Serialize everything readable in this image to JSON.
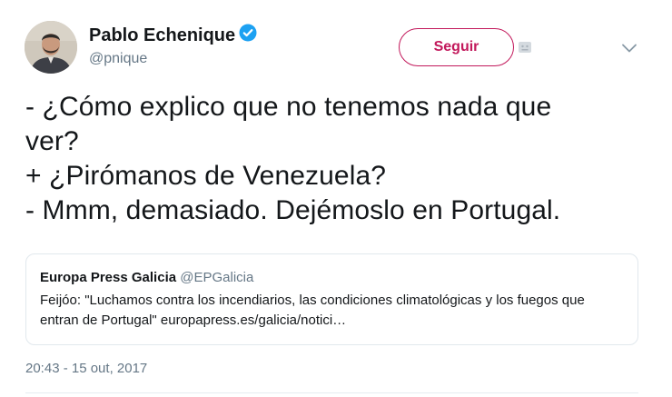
{
  "user": {
    "display_name": "Pablo Echenique",
    "handle": "@pnique",
    "verified": true
  },
  "actions": {
    "follow_label": "Seguir"
  },
  "tweet": {
    "text": "- ¿Cómo explico que no tenemos nada que\nver?\n+ ¿Pirómanos de Venezuela?\n- Mmm, demasiado. Dejémoslo en Portugal.",
    "timestamp": "20:43 - 15 out, 2017"
  },
  "quoted_tweet": {
    "display_name": "Europa Press Galicia",
    "handle": "@EPGalicia",
    "text": "Feijóo: \"Luchamos contra los incendiarios, las condiciones climatológicas y los fuegos que entran de Portugal\" europapress.es/galicia/notici…"
  },
  "colors": {
    "follow_accent": "#c2185b",
    "verified_badge": "#1da1f2",
    "secondary_text": "#657786"
  },
  "icons": {
    "verified": "verified-badge-icon",
    "follow_extra": "follow-emoji-icon",
    "menu": "chevron-down-icon"
  }
}
